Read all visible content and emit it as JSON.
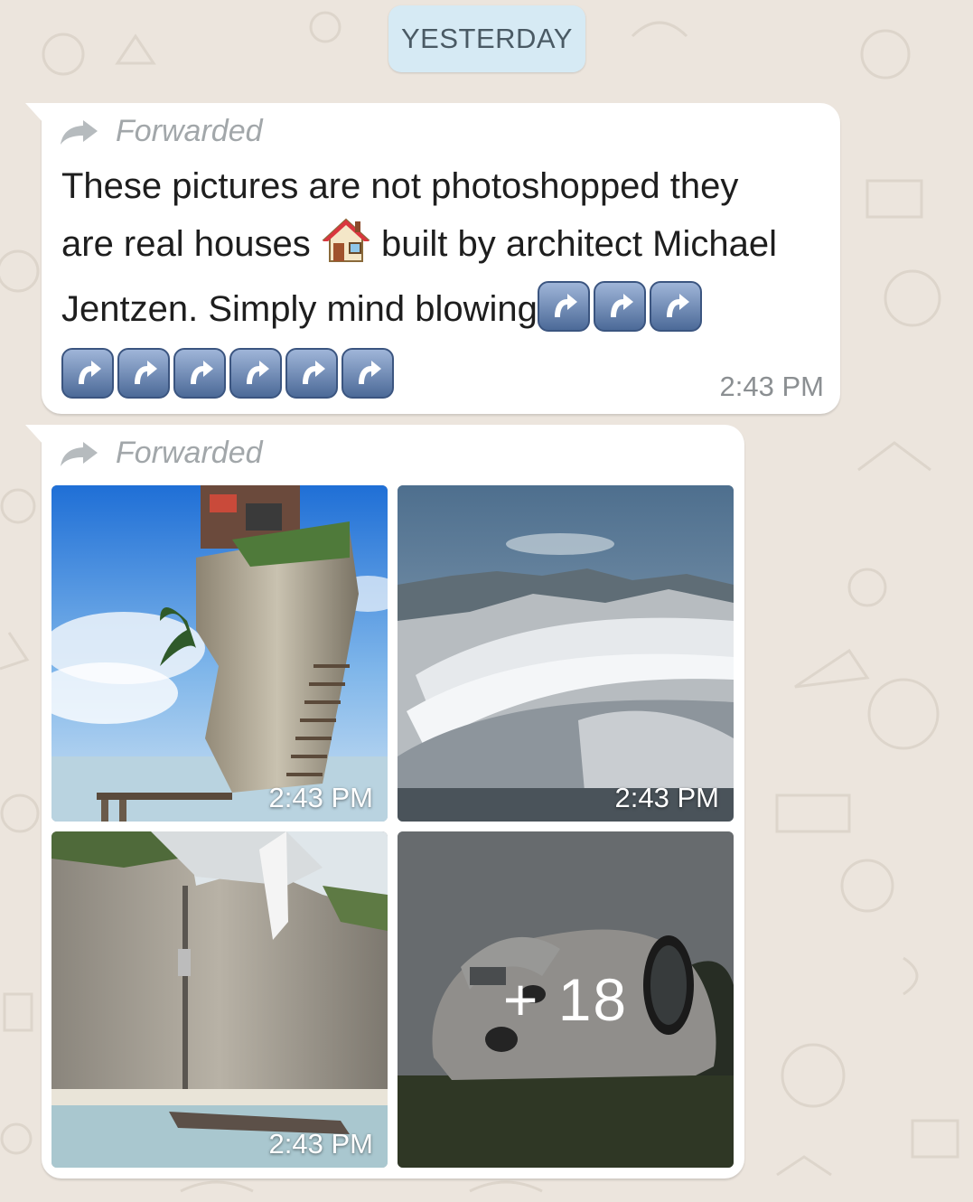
{
  "chat": {
    "date_separator": "YESTERDAY"
  },
  "messages": [
    {
      "forwarded_label": "Forwarded",
      "text_line_1": "These pictures are not photoshopped they",
      "text_line_2a": "are real houses",
      "text_line_2b": "built by architect Michael",
      "text_line_3": "Jentzen. Simply mind blowing",
      "emoji_house": "house-emoji",
      "emoji_arrow": "up-arrow-emoji",
      "arrow_emoji_count": 9,
      "time": "2:43 PM"
    },
    {
      "forwarded_label": "Forwarded",
      "photos": [
        {
          "name": "rock-tower-house",
          "time": "2:43 PM"
        },
        {
          "name": "cliff-wave-house",
          "time": "2:43 PM"
        },
        {
          "name": "cliff-elevator-house",
          "time": "2:43 PM"
        },
        {
          "name": "blob-house",
          "more_count": "+ 18"
        }
      ]
    }
  ],
  "colors": {
    "chat_background": "#ece5dd",
    "bubble": "#ffffff",
    "date_pill": "#d6eaf4",
    "timestamp": "#8b8f92",
    "forwarded": "#a2a7aa"
  }
}
